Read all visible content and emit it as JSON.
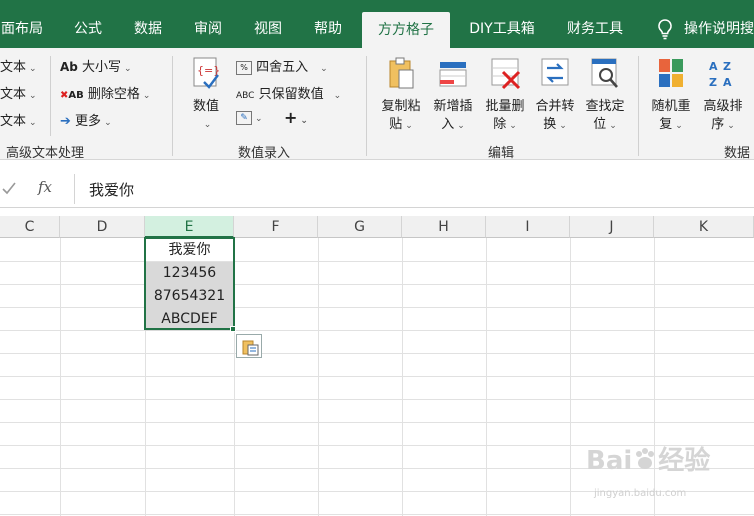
{
  "tabs": [
    {
      "label": "面布局",
      "active": false
    },
    {
      "label": "公式",
      "active": false
    },
    {
      "label": "数据",
      "active": false
    },
    {
      "label": "审阅",
      "active": false
    },
    {
      "label": "视图",
      "active": false
    },
    {
      "label": "帮助",
      "active": false
    },
    {
      "label": "方方格子",
      "active": true
    },
    {
      "label": "DIY工具箱",
      "active": false
    },
    {
      "label": "财务工具",
      "active": false
    },
    {
      "label": "操作说明搜",
      "active": false
    }
  ],
  "ribbon": {
    "text_group": {
      "left_items": [
        "文本",
        "文本",
        "文本"
      ],
      "case_label": "大小写",
      "delete_space_label": "删除空格",
      "more_label": "更多",
      "group_label": "高级文本处理"
    },
    "number_group": {
      "value_label": "数值",
      "round_label": "四舍五入",
      "keep_value_label": "只保留数值",
      "group_label": "数值录入"
    },
    "edit_group": {
      "buttons": [
        {
          "line1": "复制粘",
          "line2": "贴"
        },
        {
          "line1": "新增插",
          "line2": "入"
        },
        {
          "line1": "批量删",
          "line2": "除"
        },
        {
          "line1": "合并转",
          "line2": "换"
        },
        {
          "line1": "查找定",
          "line2": "位"
        }
      ],
      "group_label": "编辑"
    },
    "data_group": {
      "buttons": [
        {
          "line1": "随机重",
          "line2": "复"
        },
        {
          "line1": "高级排",
          "line2": "序"
        }
      ],
      "group_label": "数据"
    }
  },
  "formula_bar": {
    "fx_label": "fx",
    "value": "我爱你"
  },
  "columns": [
    "C",
    "D",
    "E",
    "F",
    "G",
    "H",
    "I",
    "J",
    "K"
  ],
  "selected_column": "E",
  "cells": [
    {
      "value": "我爱你",
      "highlight": false
    },
    {
      "value": "123456",
      "highlight": true
    },
    {
      "value": "87654321",
      "highlight": true
    },
    {
      "value": "ABCDEF",
      "highlight": true
    }
  ],
  "watermark": {
    "brand": "Bai",
    "suffix": "经验",
    "url": "jingyan.baidu.com"
  },
  "colors": {
    "accent": "#217346",
    "ribbon_bg": "#f3f3f3",
    "cell_highlight": "#d9d9d9"
  }
}
